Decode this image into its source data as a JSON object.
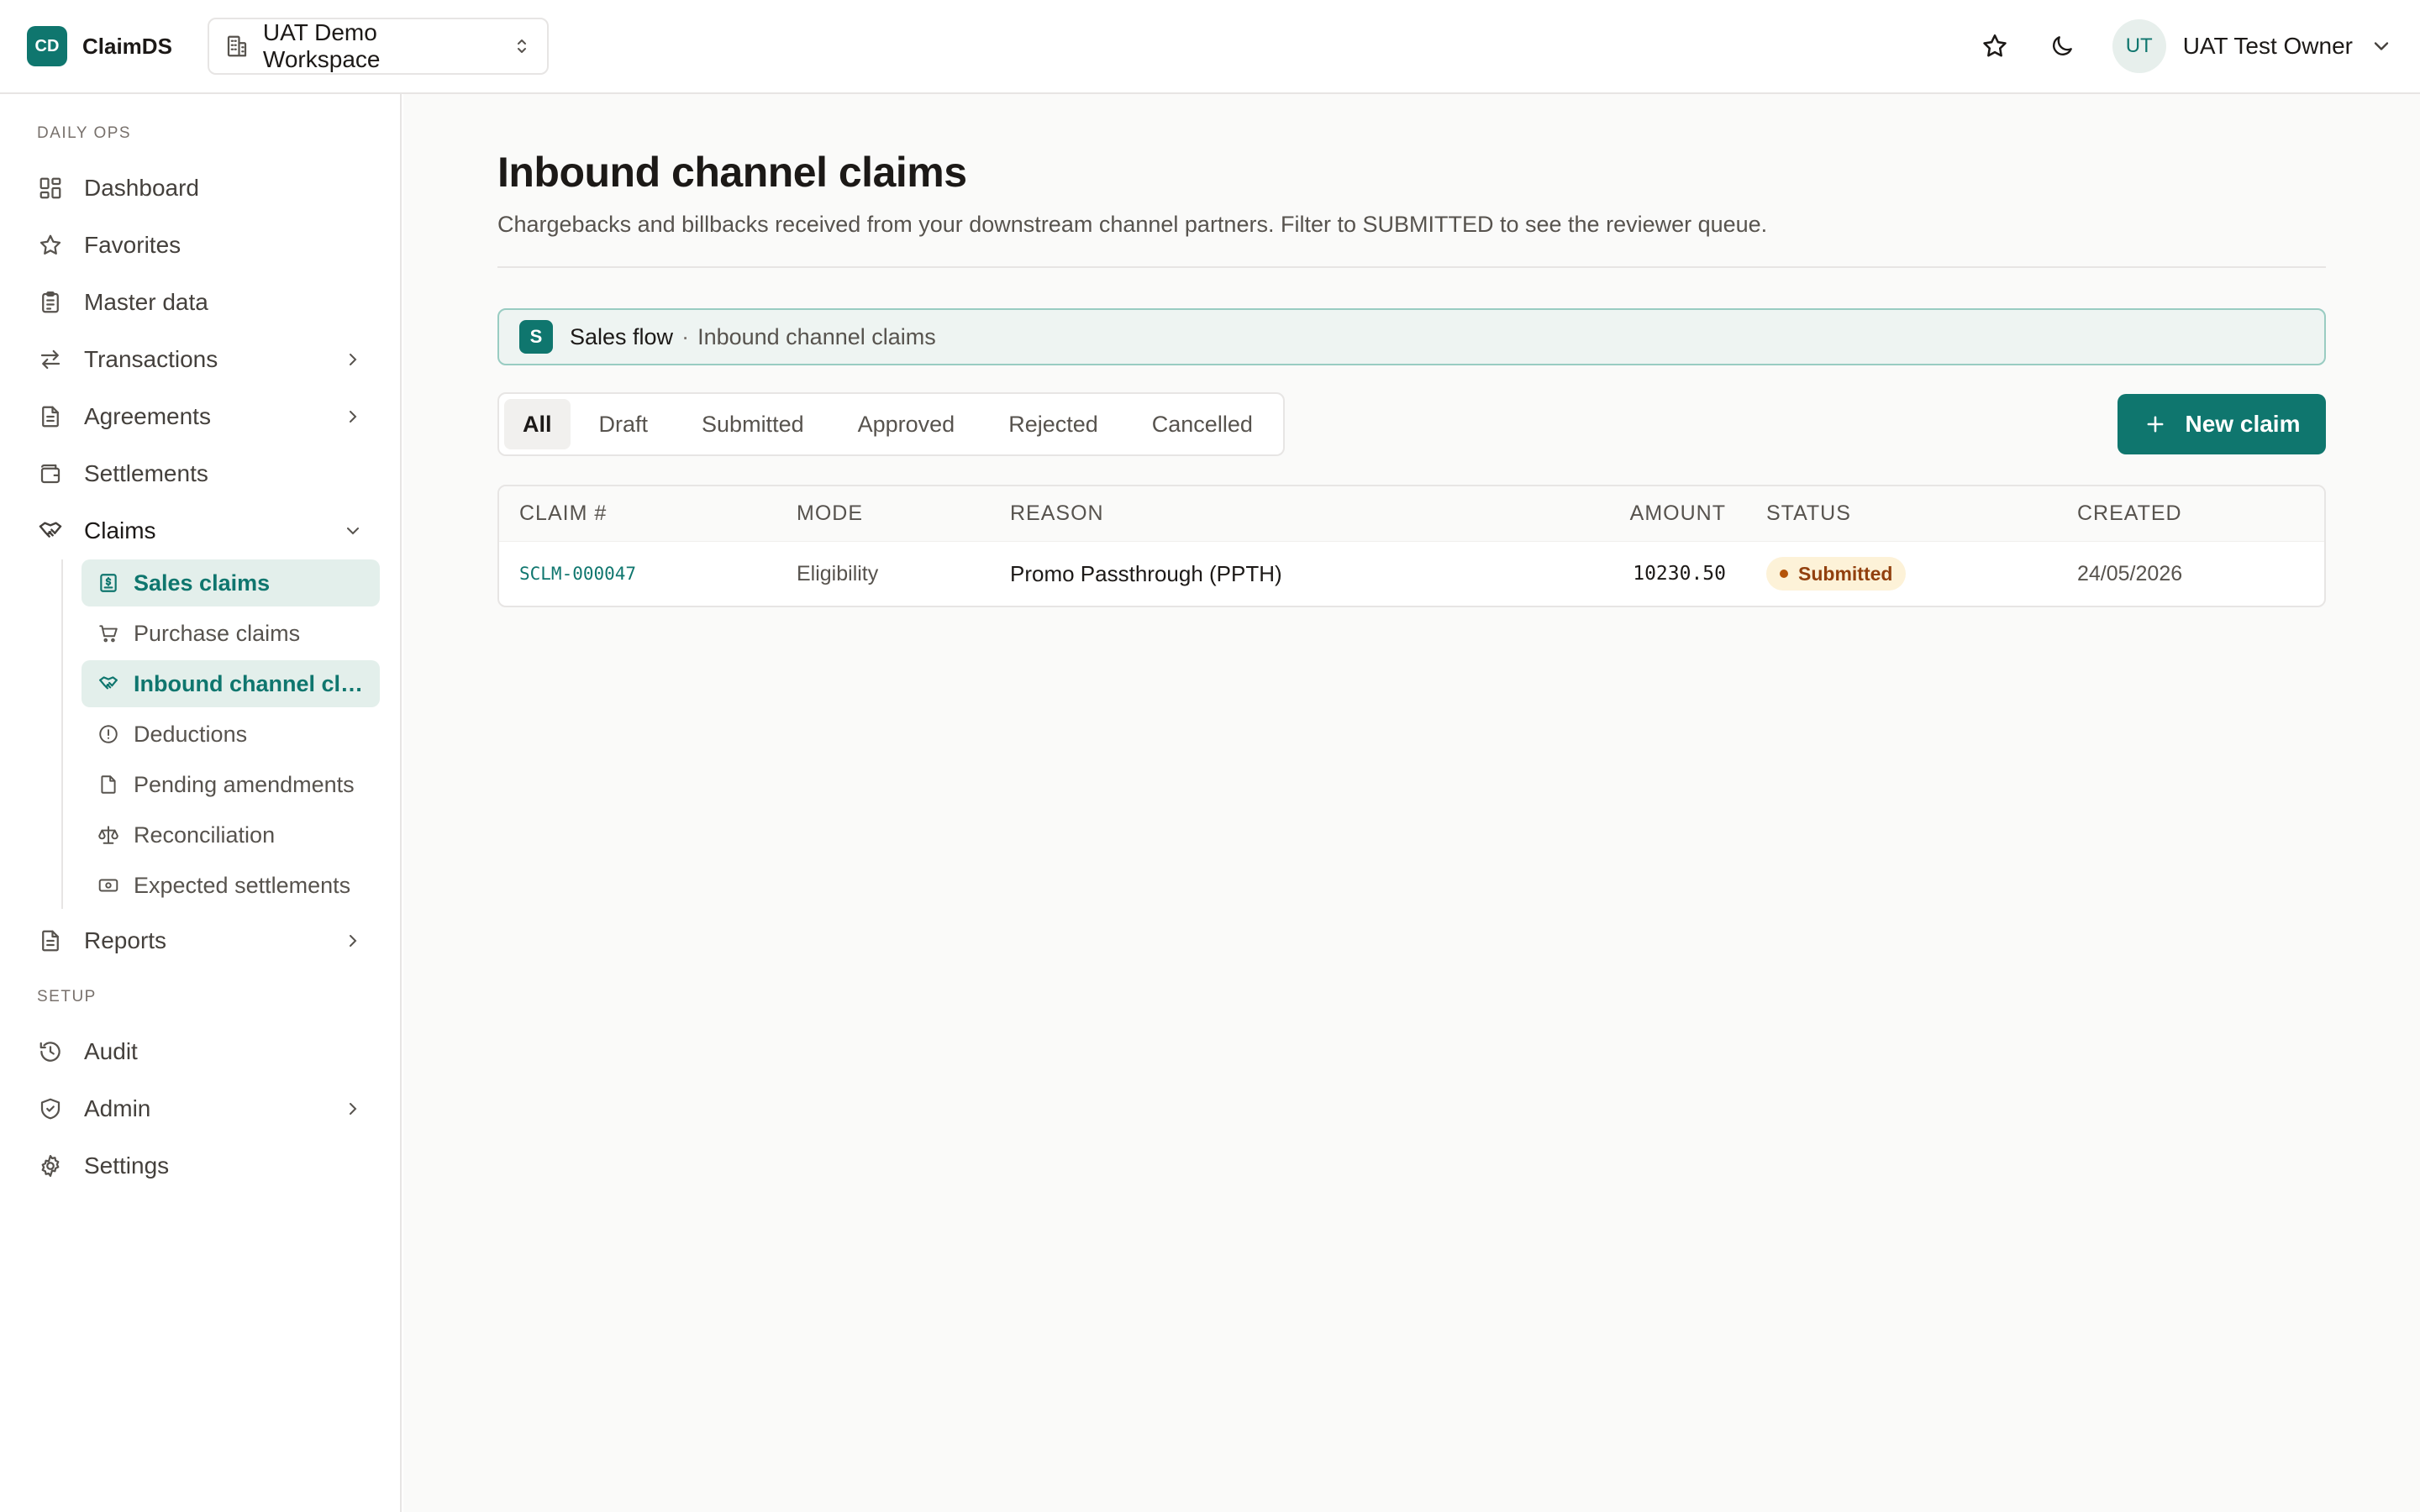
{
  "app": {
    "logo_text": "CD",
    "name": "ClaimDS"
  },
  "workspace": {
    "label": "UAT Demo Workspace",
    "icon": "building-icon"
  },
  "header": {
    "favorite_icon": "star-icon",
    "theme_icon": "moon-icon",
    "user": {
      "initials": "UT",
      "name": "UAT Test Owner"
    }
  },
  "sidebar": {
    "sections": {
      "daily_ops": "DAILY OPS",
      "setup": "SETUP"
    },
    "items": [
      {
        "label": "Dashboard",
        "icon": "dashboard-icon"
      },
      {
        "label": "Favorites",
        "icon": "star-icon"
      },
      {
        "label": "Master data",
        "icon": "clipboard-icon"
      },
      {
        "label": "Transactions",
        "icon": "arrows-icon"
      },
      {
        "label": "Agreements",
        "icon": "document-icon"
      },
      {
        "label": "Settlements",
        "icon": "wallet-icon"
      },
      {
        "label": "Claims",
        "icon": "handshake-icon"
      },
      {
        "label": "Reports",
        "icon": "report-icon"
      }
    ],
    "claims_sub": [
      {
        "label": "Sales claims",
        "icon": "invoice-icon"
      },
      {
        "label": "Purchase claims",
        "icon": "cart-icon"
      },
      {
        "label": "Inbound channel clai...",
        "icon": "handshake-icon"
      },
      {
        "label": "Deductions",
        "icon": "alert-circle-icon"
      },
      {
        "label": "Pending amendments",
        "icon": "file-icon"
      },
      {
        "label": "Reconciliation",
        "icon": "scale-icon"
      },
      {
        "label": "Expected settlements",
        "icon": "banknote-icon"
      }
    ],
    "setup_items": [
      {
        "label": "Audit",
        "icon": "history-icon"
      },
      {
        "label": "Admin",
        "icon": "shield-icon"
      },
      {
        "label": "Settings",
        "icon": "gear-icon"
      }
    ]
  },
  "main": {
    "title": "Inbound channel claims",
    "subtitle": "Chargebacks and billbacks received from your downstream channel partners. Filter to SUBMITTED to see the reviewer queue.",
    "flow": {
      "badge": "S",
      "name": "Sales flow",
      "separator": "·",
      "page": "Inbound channel claims"
    },
    "tabs": [
      "All",
      "Draft",
      "Submitted",
      "Approved",
      "Rejected",
      "Cancelled"
    ],
    "active_tab": "All",
    "new_button": "New claim",
    "table": {
      "columns": [
        "CLAIM #",
        "MODE",
        "REASON",
        "AMOUNT",
        "STATUS",
        "CREATED"
      ],
      "rows": [
        {
          "claim": "SCLM-000047",
          "mode": "Eligibility",
          "reason": "Promo Passthrough (PPTH)",
          "amount": "10230.50",
          "status": "Submitted",
          "created": "24/05/2026"
        }
      ]
    }
  },
  "colors": {
    "accent": "#0f766e",
    "active_bg": "#e3efeb",
    "status_submitted_bg": "#fdf2d8",
    "status_submitted_fg": "#92400e"
  }
}
